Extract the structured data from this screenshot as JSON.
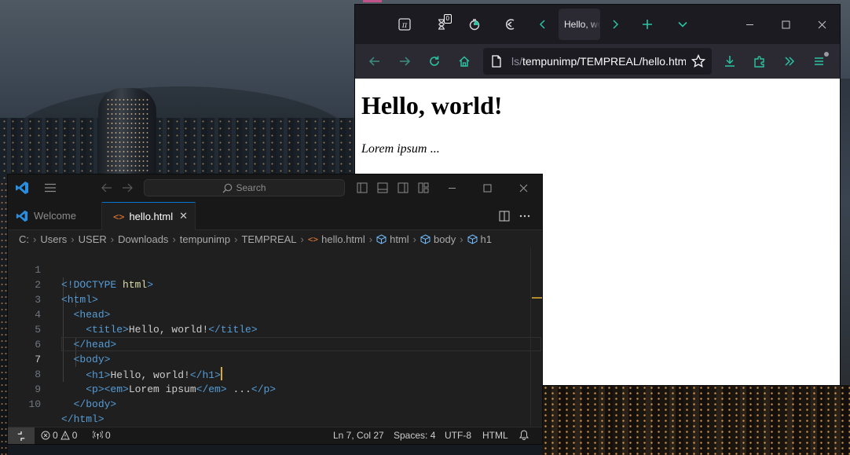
{
  "browser": {
    "toolbar_icons": [
      "pi-icon",
      "hourglass-icon",
      "timer-icon",
      "rewind-icon"
    ],
    "badge_count": "0",
    "tab": {
      "label": "Hello, world!"
    },
    "url": {
      "prefix": "ls/",
      "path": "tempunimp/TEMPREAL/hello.html"
    },
    "page": {
      "heading": "Hello, world!",
      "em_text": "Lorem ipsum",
      "rest_text": " ..."
    },
    "accent_color": "#2ac3a2"
  },
  "vscode": {
    "search_placeholder": "Search",
    "tabs": [
      {
        "label": "Welcome"
      },
      {
        "label": "hello.html"
      }
    ],
    "breadcrumb": [
      "C:",
      "Users",
      "USER",
      "Downloads",
      "tempunimp",
      "TEMPREAL",
      "hello.html",
      "html",
      "body",
      "h1"
    ],
    "line_numbers": [
      "1",
      "2",
      "3",
      "4",
      "5",
      "6",
      "7",
      "8",
      "9",
      "10"
    ],
    "code_lines": [
      "<!DOCTYPE html>",
      "<html>",
      "  <head>",
      "    <title>Hello, world!</title>",
      "  </head>",
      "  <body>",
      "    <h1>Hello, world!</h1>",
      "    <p><em>Lorem ipsum</em> ...</p>",
      "  </body>",
      "</html>"
    ],
    "status": {
      "errors": "0",
      "warnings": "0",
      "ports": "0",
      "position": "Ln 7, Col 27",
      "spaces": "Spaces: 4",
      "encoding": "UTF-8",
      "language": "HTML"
    }
  }
}
